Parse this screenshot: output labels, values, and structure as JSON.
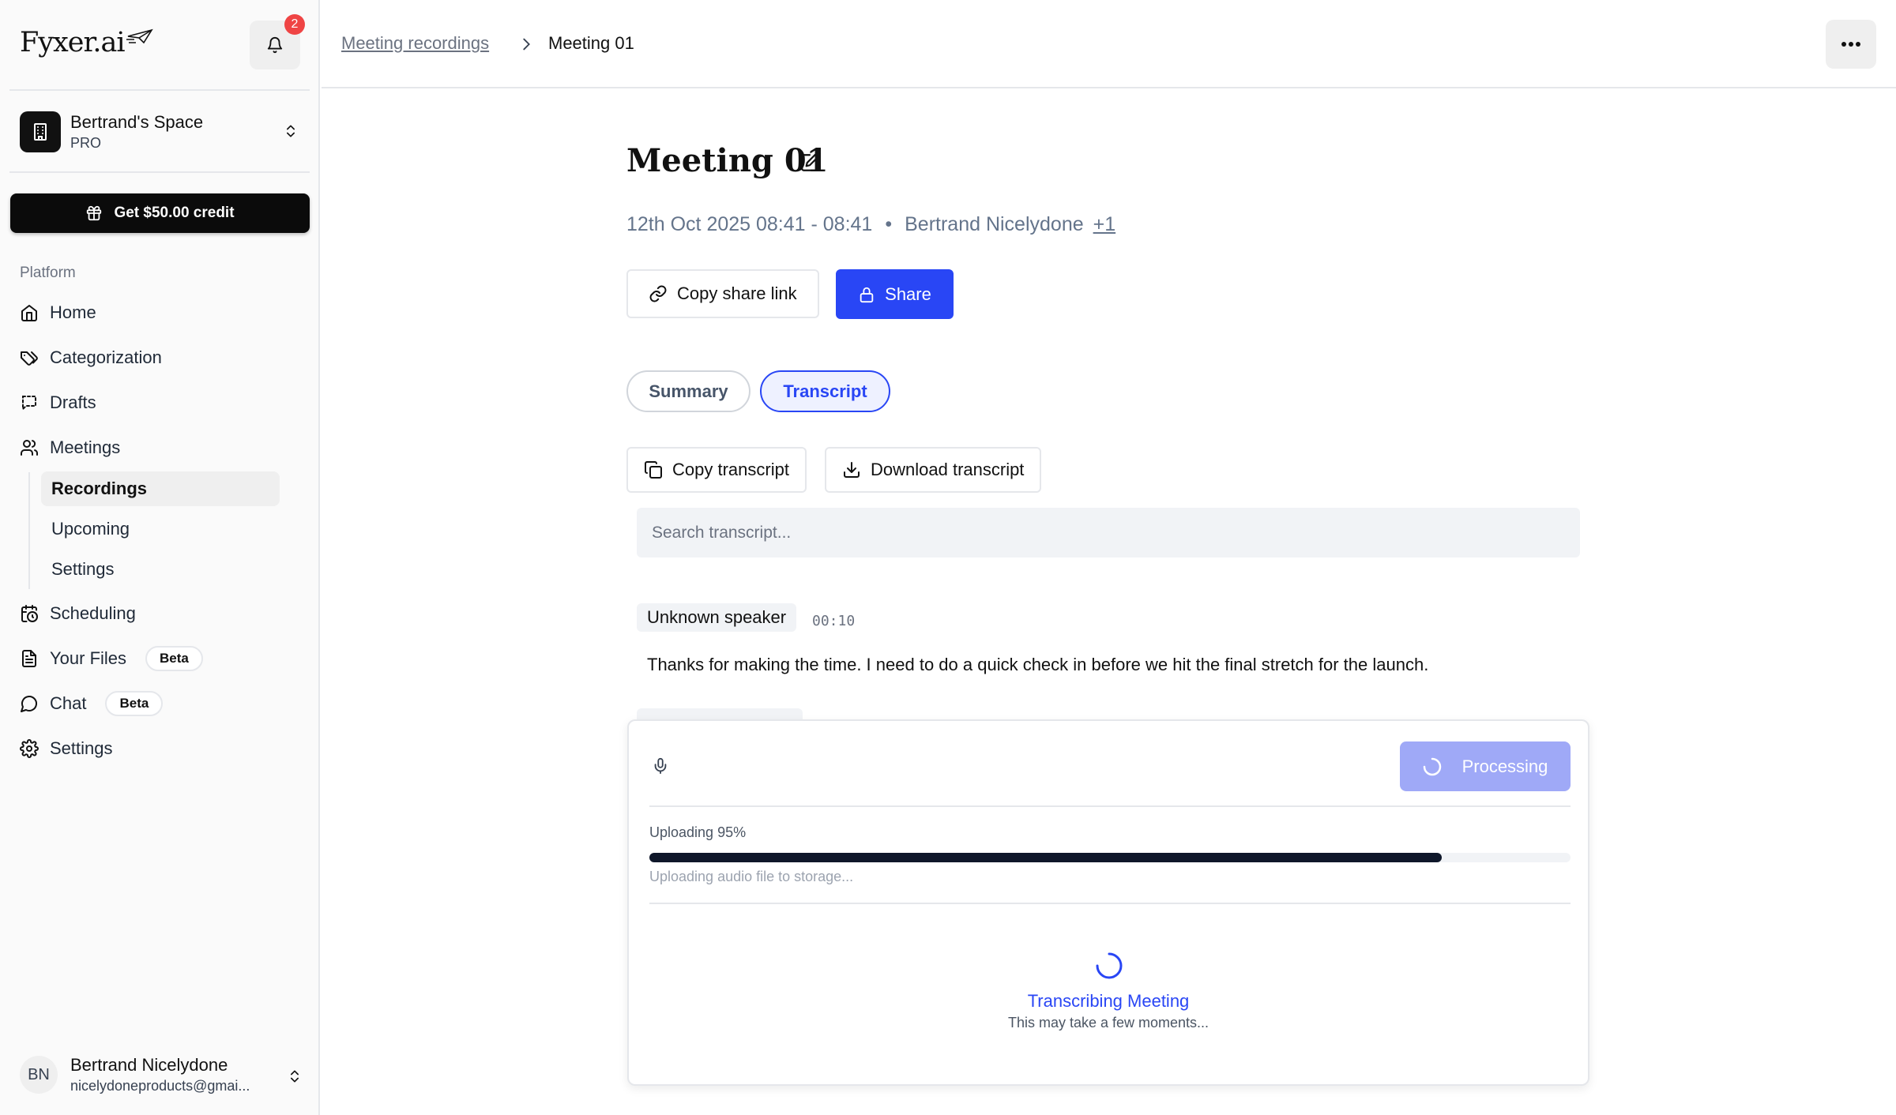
{
  "brand": {
    "logo_text": "Fyxer.ai"
  },
  "notifications": {
    "count": "2"
  },
  "workspace": {
    "name": "Bertrand's Space",
    "plan": "PRO"
  },
  "credit_button": "Get $50.00 credit",
  "sidebar": {
    "section_label": "Platform",
    "items": [
      {
        "label": "Home",
        "icon": "home-icon"
      },
      {
        "label": "Categorization",
        "icon": "tag-icon"
      },
      {
        "label": "Drafts",
        "icon": "drafts-icon"
      },
      {
        "label": "Meetings",
        "icon": "users-icon"
      },
      {
        "label": "Scheduling",
        "icon": "calendar-clock-icon"
      },
      {
        "label": "Your Files",
        "icon": "file-icon",
        "badge": "Beta"
      },
      {
        "label": "Chat",
        "icon": "chat-icon",
        "badge": "Beta"
      },
      {
        "label": "Settings",
        "icon": "gear-icon"
      }
    ],
    "meetings_sub": [
      {
        "label": "Recordings",
        "active": true
      },
      {
        "label": "Upcoming"
      },
      {
        "label": "Settings"
      }
    ]
  },
  "user": {
    "initials": "BN",
    "name": "Bertrand Nicelydone",
    "email": "nicelydoneproducts@gmai..."
  },
  "breadcrumb": {
    "parent": "Meeting recordings",
    "current": "Meeting 01"
  },
  "meeting": {
    "title": "Meeting 01",
    "datetime": "12th Oct 2025 08:41 - 08:41",
    "separator": "•",
    "owner": "Bertrand Nicelydone",
    "extra_participants": "+1"
  },
  "actions": {
    "copy_link": "Copy share link",
    "share": "Share"
  },
  "tabs": {
    "summary": "Summary",
    "transcript": "Transcript",
    "active": "transcript"
  },
  "transcript_tools": {
    "copy": "Copy transcript",
    "download": "Download transcript",
    "search_placeholder": "Search transcript..."
  },
  "transcript": [
    {
      "speaker": "Unknown speaker",
      "time": "00:10",
      "text": "Thanks for making the time. I need to do a quick check in before we hit the final stretch for the launch."
    }
  ],
  "recording_panel": {
    "processing_label": "Processing",
    "upload_label": "Uploading 95%",
    "upload_progress": 0.86,
    "upload_status": "Uploading audio file to storage...",
    "transcribing_title": "Transcribing Meeting",
    "transcribing_sub": "This may take a few moments..."
  },
  "colors": {
    "accent": "#2946f5",
    "accent_light": "#9fa9f7",
    "badge_red": "#ef4444"
  }
}
